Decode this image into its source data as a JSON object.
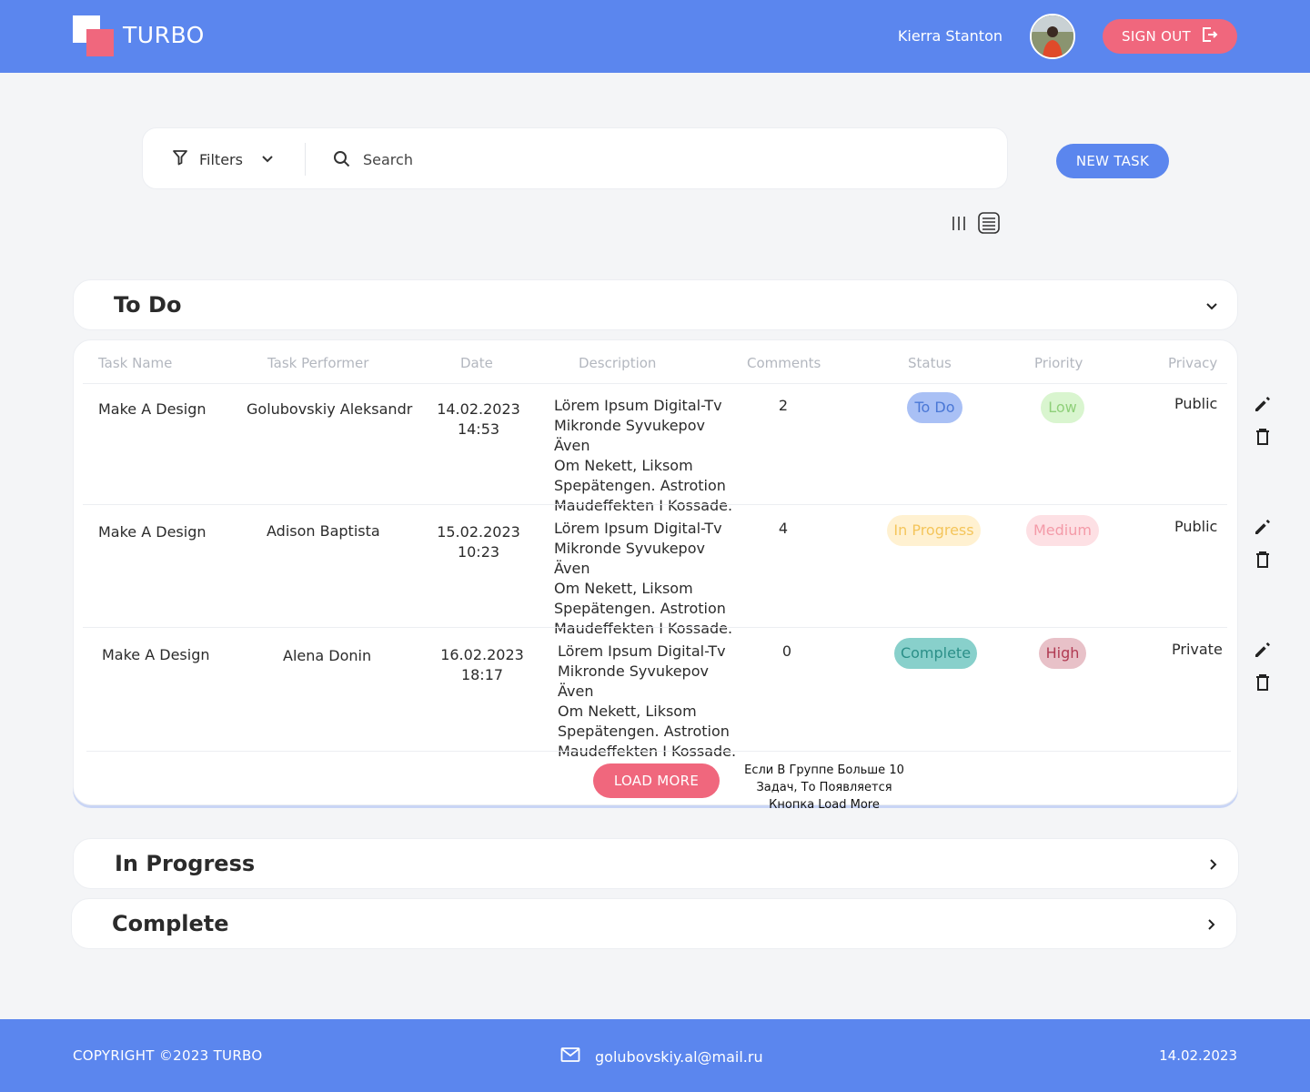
{
  "header": {
    "logo_text": "TURBO",
    "user_name": "Kierra Stanton",
    "signout_label": "SIGN OUT"
  },
  "toolbar": {
    "filters_label": "Filters",
    "search_placeholder": "Search",
    "new_task_label": "NEW TASK"
  },
  "groups": {
    "todo": "To Do",
    "in_progress": "In Progress",
    "complete": "Complete"
  },
  "table": {
    "columns": [
      "Task Name",
      "Task Performer",
      "Date",
      "Description",
      "Comments",
      "Status",
      "Priority",
      "Privacy"
    ],
    "rows": [
      {
        "name": "Make A Design",
        "performer": "Golubovskiy Aleksandr",
        "date": "14.02.2023",
        "time": "14:53",
        "description": [
          "Lörem Ipsum Digital-Tv",
          "Mikronde Syvukepov Även",
          "Om Nekett, Liksom",
          "Spepätengen. Astrotion",
          "Maudeffekten I Kossade."
        ],
        "comments": "2",
        "status": "To Do",
        "priority": "Low",
        "privacy": "Public"
      },
      {
        "name": "Make A Design",
        "performer": "Adison Baptista",
        "date": "15.02.2023",
        "time": "10:23",
        "description": [
          "Lörem Ipsum Digital-Tv",
          "Mikronde Syvukepov Även",
          "Om Nekett, Liksom",
          "Spepätengen. Astrotion",
          "Maudeffekten I Kossade."
        ],
        "comments": "4",
        "status": "In Progress",
        "priority": "Medium",
        "privacy": "Public"
      },
      {
        "name": "Make A Design",
        "performer": "Alena Donin",
        "date": "16.02.2023",
        "time": "18:17",
        "description": [
          "Lörem Ipsum Digital-Tv",
          "Mikronde Syvukepov Även",
          "Om Nekett, Liksom",
          "Spepätengen. Astrotion",
          "Maudeffekten I Kossade."
        ],
        "comments": "0",
        "status": "Complete",
        "priority": "High",
        "privacy": "Private"
      }
    ],
    "load_more_label": "LOAD MORE",
    "note": [
      "Если В Группе Больше 10",
      "Задач, То Появляется",
      "Кнопка Load More"
    ]
  },
  "footer": {
    "copyright": "COPYRIGHT ©2023 TURBO",
    "email": "golubovskiy.al@mail.ru",
    "date": "14.02.2023"
  },
  "colors": {
    "brand_blue": "#5b86ee",
    "accent_pink": "#f0677d",
    "status_todo_bg": "#a9c0f5",
    "status_todo_fg": "#4a77d6",
    "status_progress_bg": "#fff1d1",
    "status_progress_fg": "#f4c55b",
    "status_complete_bg": "#88d0cb",
    "status_complete_fg": "#2b8f88",
    "priority_low_bg": "#d9f5cf",
    "priority_low_fg": "#8fd07a",
    "priority_medium_bg": "#fde0e4",
    "priority_medium_fg": "#f49aa8",
    "priority_high_bg": "#e8c1c8",
    "priority_high_fg": "#b03a52"
  },
  "icons": {
    "filter": "filter-icon",
    "chevron": "chevron-down-icon",
    "search": "search-icon",
    "signout": "signout-icon",
    "columns_view": "columns-view-icon",
    "list_view": "list-view-icon",
    "edit": "pencil-icon",
    "delete": "trash-icon",
    "mail": "mail-icon"
  }
}
